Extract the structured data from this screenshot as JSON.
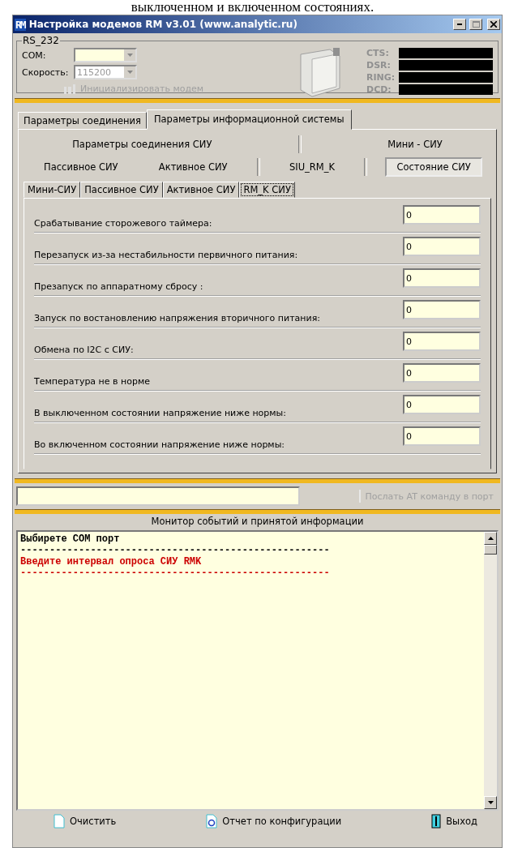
{
  "caption": "выключенном и включенном состояниях.",
  "window": {
    "title": "Настройка модемов RM v3.01 (www.analytic.ru)",
    "logo": "RM"
  },
  "rs232": {
    "title": "RS_232",
    "com_label": "COM:",
    "speed_label": "Скорость:",
    "speed_value": "115200",
    "init_button": "Инициализировать модем",
    "init_disabled": true
  },
  "signals": [
    {
      "label": "CTS:"
    },
    {
      "label": "DSR:"
    },
    {
      "label": "RING:"
    },
    {
      "label": "DCD:"
    }
  ],
  "tabs": [
    {
      "label": "Параметры соединения",
      "selected": false
    },
    {
      "label": "Параметры информационной  системы",
      "selected": true
    }
  ],
  "group_rows": [
    [
      {
        "label": "Параметры соединения СИУ",
        "selected": false,
        "divider_after": true
      },
      {
        "label": "Мини - СИУ",
        "selected": false,
        "divider_after": false
      }
    ],
    [
      {
        "label": "Пассивное СИУ",
        "selected": false,
        "divider_after": false
      },
      {
        "label": "Активное СИУ",
        "selected": false,
        "divider_after": true
      },
      {
        "label": "SIU_RM_K",
        "selected": false,
        "divider_after": true
      },
      {
        "label": "Состояние СИУ",
        "selected": true,
        "divider_after": false
      }
    ]
  ],
  "inner_tabs": [
    {
      "label": "Мини-СИУ",
      "selected": false
    },
    {
      "label": "Пассивное СИУ",
      "selected": false
    },
    {
      "label": "Активное СИУ",
      "selected": false
    },
    {
      "label": "RM_K СИУ",
      "selected": true
    }
  ],
  "fields": [
    {
      "label": "Срабатывание сторожевого таймера:",
      "value": "0"
    },
    {
      "label": "Перезапуск из-за нестабильности первичного питания:",
      "value": "0"
    },
    {
      "label": "Презапуск по аппаратному сбросу :",
      "value": "0"
    },
    {
      "label": "Запуск по востановлению напряжения вторичного питания:",
      "value": "0"
    },
    {
      "label": "Обмена по I2C с СИУ:",
      "value": "0"
    },
    {
      "label": "Температура не в норме",
      "value": "0"
    },
    {
      "label": "В выключенном состоянии  напряжение ниже нормы:",
      "value": "0"
    },
    {
      "label": "Во включенном состоянии  напряжение ниже нормы:",
      "value": "0"
    }
  ],
  "at_command": {
    "button": "Послать AT команду в порт",
    "disabled": true
  },
  "monitor": {
    "title": "Монитор событий и  принятой информации",
    "lines": [
      {
        "text": "Выбирете COM порт",
        "color": "#000000"
      },
      {
        "text": "-----------------------------------------------------",
        "color": "#000000"
      },
      {
        "text": "Введите интервал опроса СИУ RMK",
        "color": "#cc0000"
      },
      {
        "text": "-----------------------------------------------------",
        "color": "#cc0000"
      }
    ]
  },
  "footer_buttons": [
    {
      "label": "Очистить",
      "kind": "clear"
    },
    {
      "label": "Отчет по конфигурации",
      "kind": "report"
    },
    {
      "label": "Выход",
      "kind": "exit"
    }
  ]
}
